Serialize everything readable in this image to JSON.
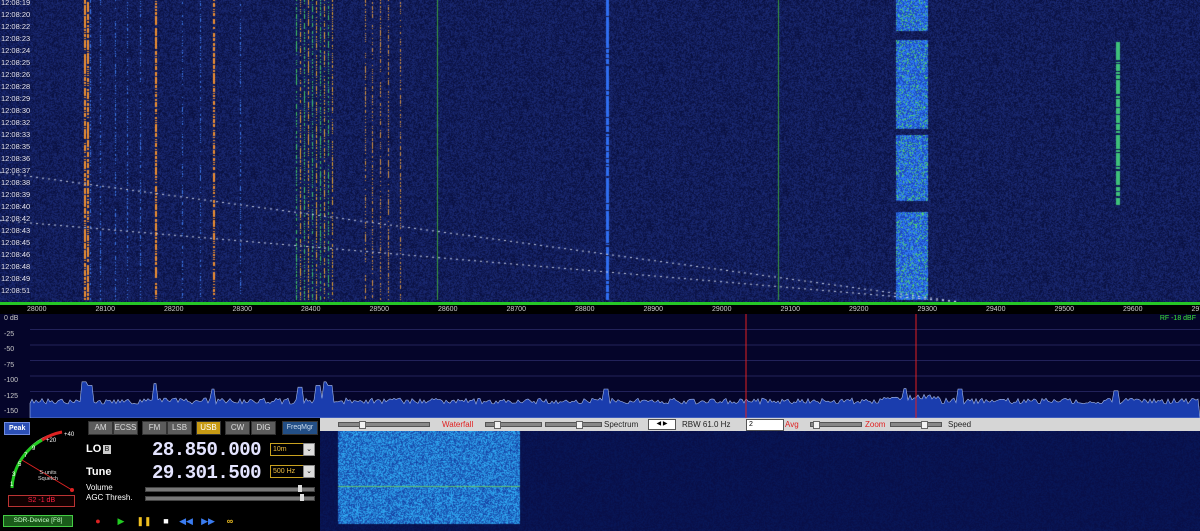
{
  "waterfall": {
    "timestamps": [
      "12:08:19",
      "12:08:20",
      "12:08:22",
      "12:08:23",
      "12:08:24",
      "12:08:25",
      "12:08:26",
      "12:08:28",
      "12:08:29",
      "12:08:30",
      "12:08:32",
      "12:08:33",
      "12:08:35",
      "12:08:36",
      "12:08:37",
      "12:08:38",
      "12:08:39",
      "12:08:40",
      "12:08:42",
      "12:08:43",
      "12:08:45",
      "12:08:46",
      "12:08:48",
      "12:08:49",
      "12:08:51"
    ]
  },
  "freq_axis": {
    "labels": [
      "28000",
      "28100",
      "28200",
      "28300",
      "28400",
      "28500",
      "28600",
      "28700",
      "28800",
      "28900",
      "29000",
      "29100",
      "29200",
      "29300",
      "29400",
      "29500",
      "29600",
      "29700"
    ]
  },
  "spectrum": {
    "db_labels": [
      "0 dB",
      "-25",
      "-50",
      "-75",
      "-100",
      "-125",
      "-150"
    ],
    "rf_label": "RF -18 dBF"
  },
  "smeter": {
    "peak_label": "Peak",
    "scale": [
      "1",
      "3",
      "5",
      "7",
      "9",
      "+20",
      "+40"
    ],
    "title_line1": "S-units",
    "title_line2": "Squelch",
    "reading": "S2 -1 dB"
  },
  "device_label": "SDR-Device [F8]",
  "modes": [
    "AM",
    "ECSS",
    "FM",
    "LSB",
    "USB",
    "CW",
    "DIG"
  ],
  "freqmgr_label": "FreqMgr",
  "lo": {
    "label": "LO",
    "badge": "B",
    "value": "28.850.000",
    "band": "10m"
  },
  "tune": {
    "label": "Tune",
    "value": "29.301.500",
    "step": "500 Hz"
  },
  "sliders": {
    "volume": "Volume",
    "agc": "AGC Thresh."
  },
  "toolbar": {
    "waterfall": "Waterfall",
    "spectrum": "Spectrum",
    "rbw": "RBW 61.0 Hz",
    "avg_value": "2",
    "avg": "Avg",
    "zoom": "Zoom",
    "speed": "Speed"
  },
  "colors": {
    "accent": "#c79a14",
    "waterfall_bg": "#0b1454",
    "marker": "#e02020"
  }
}
